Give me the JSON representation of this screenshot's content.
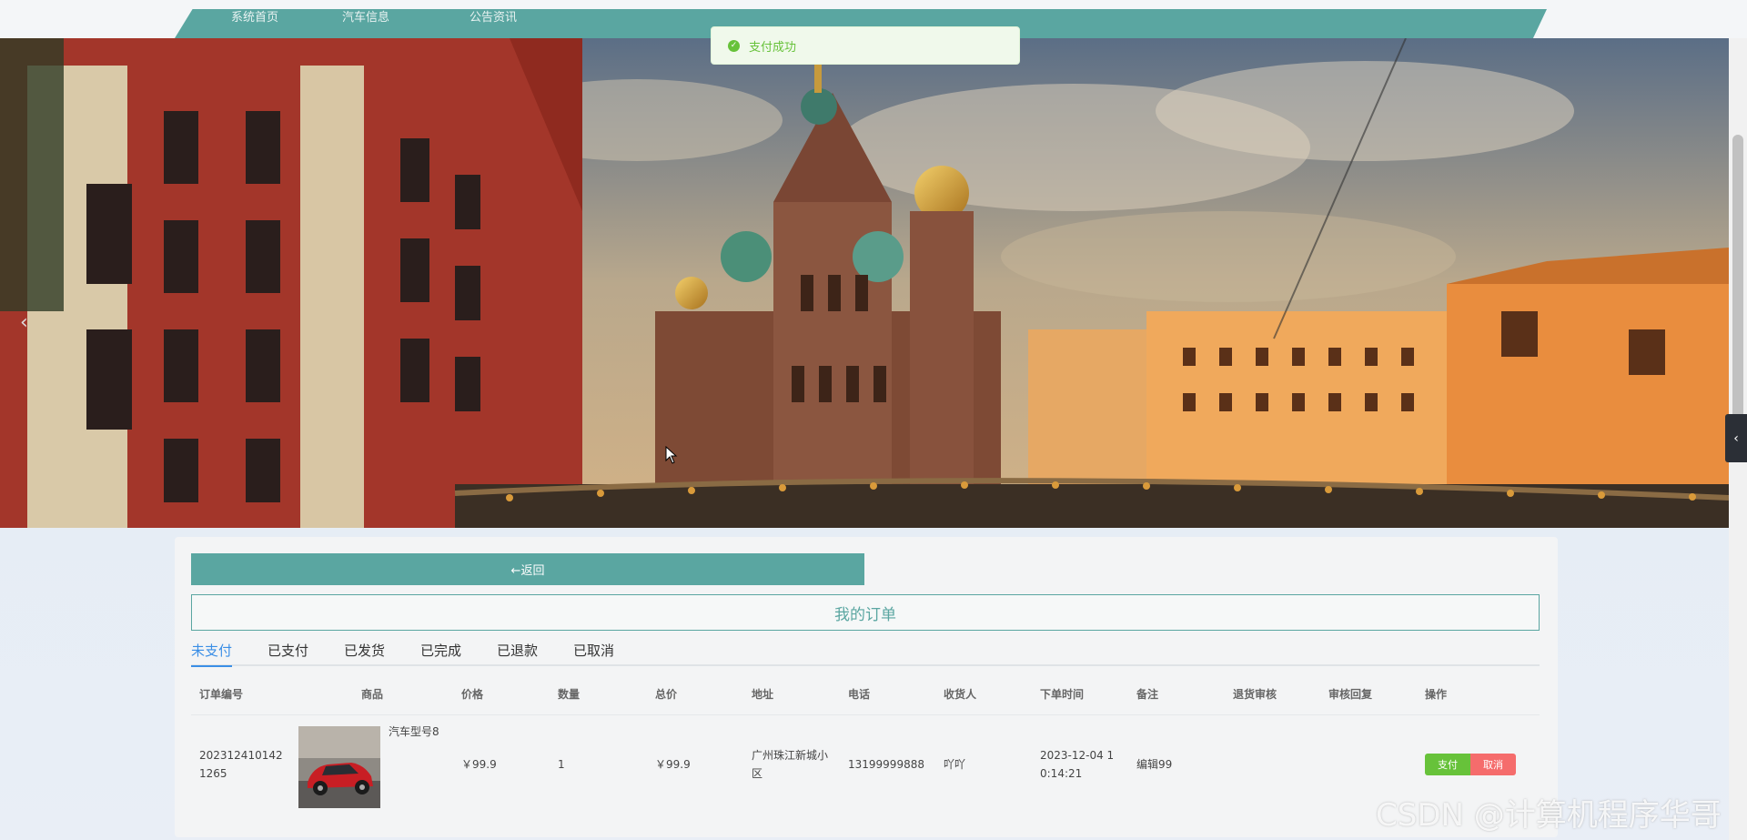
{
  "nav": {
    "items": [
      "系统首页",
      "汽车信息",
      "公告资讯"
    ]
  },
  "toast": {
    "message": "支付成功",
    "icon": "check-circle-icon",
    "color": "#67c23a"
  },
  "banner": {
    "slides": 3,
    "active_slide": 1,
    "prev_icon": "chevron-left-icon",
    "side_icon": "chevron-left-icon"
  },
  "orders": {
    "back_label": "←返回",
    "title": "我的订单",
    "tabs": [
      "未支付",
      "已支付",
      "已发货",
      "已完成",
      "已退款",
      "已取消"
    ],
    "active_tab": "未支付",
    "columns": [
      "订单编号",
      "商品",
      "价格",
      "数量",
      "总价",
      "地址",
      "电话",
      "收货人",
      "下单时间",
      "备注",
      "退货审核",
      "审核回复",
      "操作"
    ],
    "rows": [
      {
        "order_no": "2023124101421265",
        "order_no_line1": "202312410142",
        "order_no_line2": "1265",
        "product": "汽车型号8",
        "price": "￥99.9",
        "qty": "1",
        "total": "￥99.9",
        "address_line1": "广州珠江新城小",
        "address_line2": "区",
        "phone": "13199999888",
        "receiver": "吖吖",
        "time_line1": "2023-12-04 1",
        "time_line2": "0:14:21",
        "note": "编辑99",
        "return_review": "",
        "review_reply": "",
        "pay_label": "支付",
        "cancel_label": "取消"
      }
    ]
  },
  "colors": {
    "accent": "#5aa6a1",
    "tab_active": "#3a8ee6",
    "pay": "#67c23a",
    "cancel": "#f56c6c"
  },
  "watermark": "CSDN @计算机程序华哥"
}
